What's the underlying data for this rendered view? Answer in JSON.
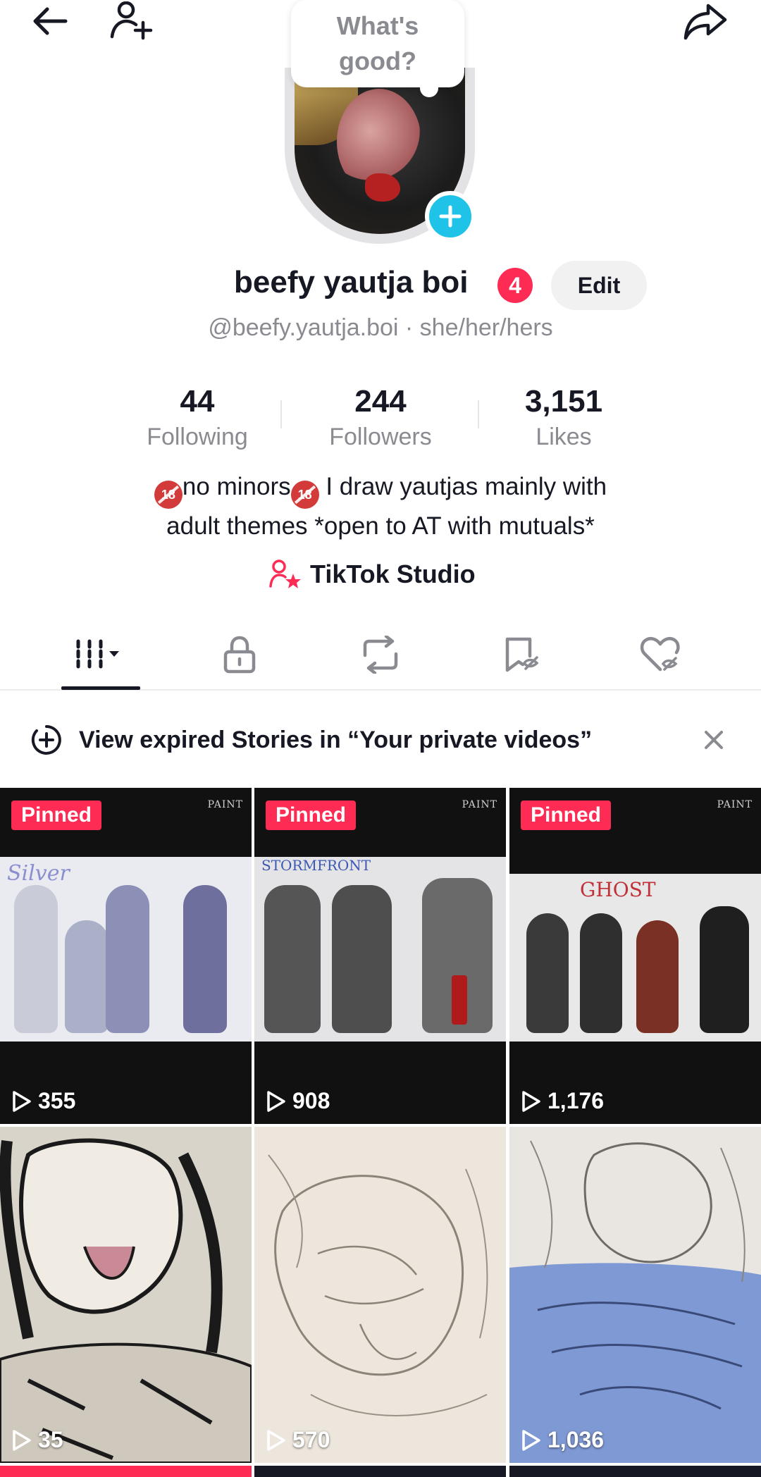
{
  "header": {
    "back_icon": "arrow-left-icon",
    "add_friend_icon": "person-plus-icon",
    "share_icon": "share-arrow-icon"
  },
  "note_bubble": {
    "text": "What's good?"
  },
  "profile": {
    "name": "beefy yautja boi",
    "notification_count": "4",
    "edit_label": "Edit",
    "handle_line": "@beefy.yautja.boi · she/her/hers"
  },
  "stats": [
    {
      "value": "44",
      "label": "Following"
    },
    {
      "value": "244",
      "label": "Followers"
    },
    {
      "value": "3,151",
      "label": "Likes"
    }
  ],
  "bio": {
    "line1_a": "no minors",
    "line1_b": " I draw yautjas mainly with",
    "line2": "adult themes *open to AT with mutuals*",
    "age_badge": "18"
  },
  "studio": {
    "label": "TikTok Studio"
  },
  "tabs": [
    "videos-grid-icon",
    "lock-icon",
    "repost-icon",
    "bookmark-icon",
    "liked-icon"
  ],
  "story_banner": {
    "text": "View expired Stories in “Your private videos”"
  },
  "videos": [
    {
      "pinned": "Pinned",
      "views": "355",
      "watermark": "PAINT",
      "sheet_title": "Silver"
    },
    {
      "pinned": "Pinned",
      "views": "908",
      "watermark": "PAINT",
      "sheet_title": "STORMFRONT"
    },
    {
      "pinned": "Pinned",
      "views": "1,176",
      "watermark": "PAINT",
      "sheet_title": "GHOST"
    },
    {
      "pinned": "",
      "views": "35"
    },
    {
      "pinned": "",
      "views": "570"
    },
    {
      "pinned": "",
      "views": "1,036"
    }
  ],
  "colors": {
    "accent": "#fe2c55",
    "plus": "#20c3e8",
    "muted": "#8a8b91"
  }
}
